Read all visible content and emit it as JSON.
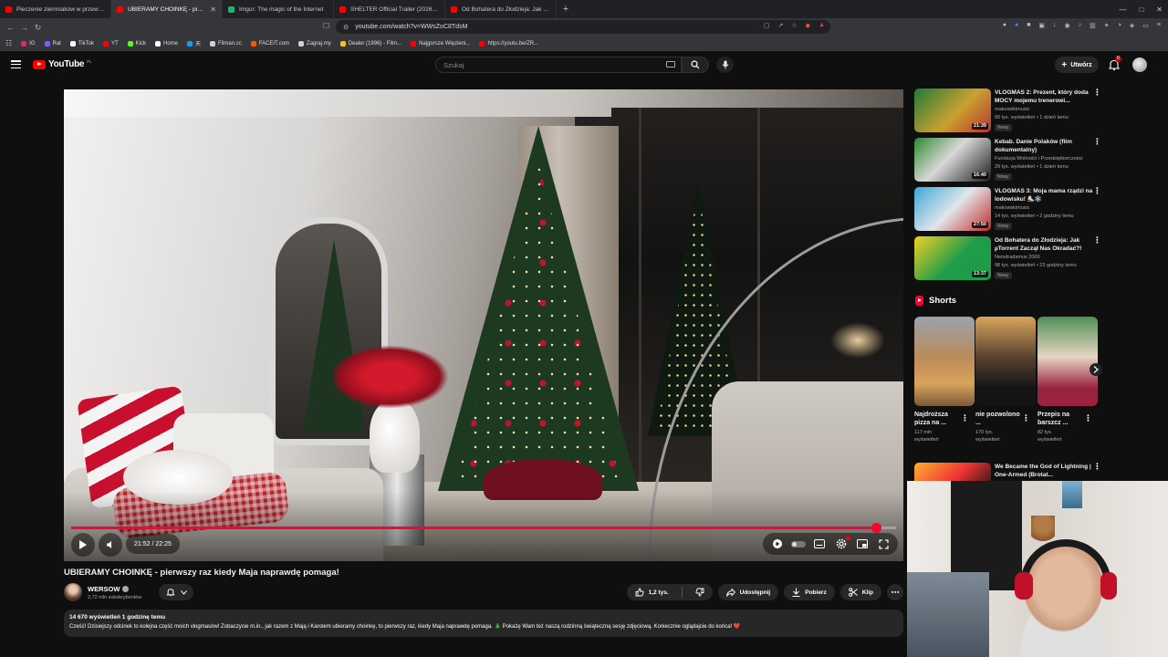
{
  "browser": {
    "tabs": [
      {
        "title": "Pieczenie ziemniaków w przewróconym",
        "color": "#ff0000",
        "active": false
      },
      {
        "title": "UBIERAMY CHOINKĘ - pierwszy raz",
        "color": "#ff0000",
        "active": true
      },
      {
        "title": "Imgur: The magic of the Internet",
        "color": "#1bb76e",
        "active": false
      },
      {
        "title": "SHELTER Official Trailer (2026) Jason",
        "color": "#ff0000",
        "active": false
      },
      {
        "title": "Od Bohatera do Złodzieja: Jak µTorrent",
        "color": "#ff0000",
        "active": false
      }
    ],
    "url": "youtube.com/watch?v=WWsZoC8TdsM",
    "bookmarks": [
      {
        "label": "IG",
        "color": "#d62976"
      },
      {
        "label": "Rat",
        "color": "#7b5cff"
      },
      {
        "label": "TikTok",
        "color": "#ffffff"
      },
      {
        "label": "YT",
        "color": "#ff0000"
      },
      {
        "label": "Kick",
        "color": "#53fc18"
      },
      {
        "label": "Home",
        "color": "#ffffff"
      },
      {
        "label": "天",
        "color": "#1d9bf0"
      },
      {
        "label": "Filman.cc",
        "color": "#cfcfcf"
      },
      {
        "label": "FACEIT.com",
        "color": "#ff5500"
      },
      {
        "label": "Zagraj.my",
        "color": "#cfcfcf"
      },
      {
        "label": "Dealer (1996) - Film...",
        "color": "#f5c518"
      },
      {
        "label": "Najgorsze Więzieni...",
        "color": "#ff0000"
      },
      {
        "label": "https://youtu.be/ZR...",
        "color": "#ff0000"
      }
    ]
  },
  "header": {
    "logo_text": "YouTube",
    "country": "PL",
    "search_placeholder": "Szukaj",
    "create_label": "Utwórz",
    "notif_count": "9"
  },
  "player": {
    "current_time": "21:52",
    "duration": "22:25",
    "time_text": "21:52 / 22:25",
    "progress_fraction": 0.9755
  },
  "video": {
    "title": "UBIERAMY CHOINKĘ - pierwszy raz kiedy Maja naprawdę pomaga!",
    "channel": "WERSOW",
    "subscribers": "2,72 mln subskrybentów",
    "likes": "1,2 tys.",
    "share_label": "Udostępnij",
    "download_label": "Pobierz",
    "clip_label": "Klip",
    "views_meta": "14 670 wyświetleń  1 godzinę temu",
    "description": "Cześć! Dzisiejszy odcinek to kolejna część moich vlogmasów! Zobaczycie m.in., jak razem z Mają i Karolem ubieramy choinkę, to pierwszy raz, kiedy Maja naprawdę pomaga. 🎄 Pokażę Wam też naszą rodzinną świąteczną sesję zdjęciową. Koniecznie oglądajcie do końca! ❤️"
  },
  "sidebar": {
    "items": [
      {
        "title": "VLOGMAS 2: Prezent, który doda MOCY mojemu trenerowi...",
        "channel": "makowskimusic",
        "meta": "90 tys. wyświetleń • 1 dzień temu",
        "badge": "Nowy",
        "duration": "21:39",
        "thumb_bg": "linear-gradient(135deg,#1f7a3a,#c9a22f 55%,#b8342f)"
      },
      {
        "title": "Kebab. Danie Polaków (film dokumentalny)",
        "channel": "Fundacja Wolności i Przedsiębiorczości",
        "meta": "29 tys. wyświetleń • 1 dzień temu",
        "badge": "Nowy",
        "duration": "16:40",
        "thumb_bg": "linear-gradient(135deg,#2c8a2c,#d8d8d8 45%,#1c1c1c)"
      },
      {
        "title": "VLOGMAS 3: Moja mama rządzi na lodowisku! ⛸️❄️",
        "channel": "makowskimusic",
        "meta": "14 tys. wyświetleń • 2 godziny temu",
        "badge": "Nowy",
        "duration": "27:50",
        "thumb_bg": "linear-gradient(135deg,#3aa7d8,#e0e6ea 50%,#c22b2b)"
      },
      {
        "title": "Od Bohatera do Złodzieja: Jak µTorrent Zaczął Nas Okradać?!",
        "channel": "Neostradamus 2000",
        "meta": "98 tys. wyświetleń • 23 godziny temu",
        "badge": "Nowy",
        "duration": "13:37",
        "thumb_bg": "linear-gradient(135deg,#f3d21f,#1e9c4a 55%,#1e9c4a)"
      }
    ],
    "partial_item": {
      "title": "We Became the God of Lightning | One-Armed (Brotat...",
      "thumb_bg": "linear-gradient(135deg,#ffb02e,#e33 60%,#4a1a1a)"
    },
    "shorts_title": "Shorts",
    "shorts": [
      {
        "title": "Najdroższa pizza na ...",
        "views": "117 mln wyświetleń",
        "thumb_bg": "linear-gradient(180deg,#9aa3ad,#b98b5a 45%,#d9a35b 75%,#7a5a3a)"
      },
      {
        "title": "nie pozwolono ...",
        "views": "170 tys. wyświetleń",
        "thumb_bg": "linear-gradient(180deg,#d8a55c,#5a4330 45%,#141414 80%)"
      },
      {
        "title": "Przepis na barszcz ...",
        "views": "82 tys. wyświetleń",
        "thumb_bg": "linear-gradient(180deg,#4f8f57,#e6d6c3 45%,#9a2340 80%)"
      }
    ]
  },
  "colors": {
    "accent": "#ff0033",
    "bg": "#0f0f0f",
    "pill": "#272727"
  }
}
